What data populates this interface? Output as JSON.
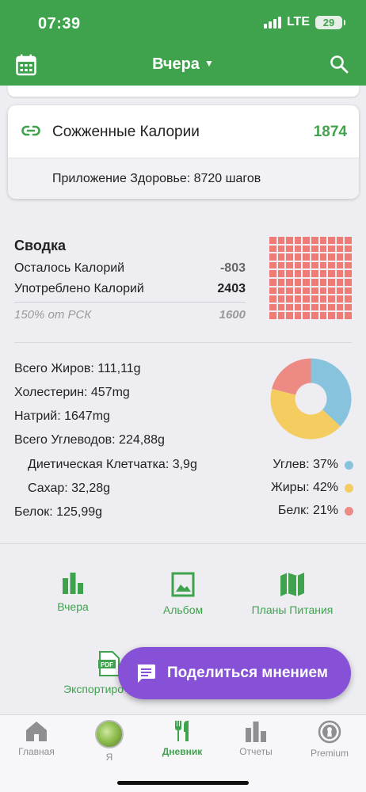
{
  "status": {
    "time": "07:39",
    "network": "LTE",
    "battery": "29"
  },
  "header": {
    "title": "Вчера"
  },
  "burned": {
    "label": "Сожженные Калории",
    "value": "1874",
    "health": "Приложение Здоровье: 8720 шагов"
  },
  "summary": {
    "title": "Сводка",
    "remaining_label": "Осталось Калорий",
    "remaining_value": "-803",
    "consumed_label": "Употреблено Калорий",
    "consumed_value": "2403",
    "rdi_label": "150% от РСК",
    "rdi_value": "1600"
  },
  "nutrients": [
    "Всего Жиров: 111,11g",
    "Холестерин: 457mg",
    "Натрий: 1647mg",
    "Всего Углеводов: 224,88g",
    "Диетическая Клетчатка: 3,9g",
    "Сахар: 32,28g",
    "Белок: 125,99g"
  ],
  "macros": {
    "carbs_label": "Углев: 37%",
    "fat_label": "Жиры: 42%",
    "protein_label": "Белк: 21%",
    "carbs": 37,
    "fat": 42,
    "protein": 21,
    "colors": {
      "carbs": "#87c3dd",
      "fat": "#f4cc60",
      "protein": "#ec8a83"
    }
  },
  "actions": {
    "yesterday": "Вчера",
    "album": "Альбом",
    "meal_plans": "Планы Питания",
    "export": "Экспортиро"
  },
  "feedback": {
    "label": "Поделиться мнением"
  },
  "tabs": {
    "home": "Главная",
    "me": "Я",
    "diary": "Дневник",
    "reports": "Отчеты",
    "premium": "Premium"
  },
  "colors": {
    "brand_green": "#3fa34d",
    "feedback_purple": "#8651d6",
    "waffle_red": "#ef7b77"
  }
}
